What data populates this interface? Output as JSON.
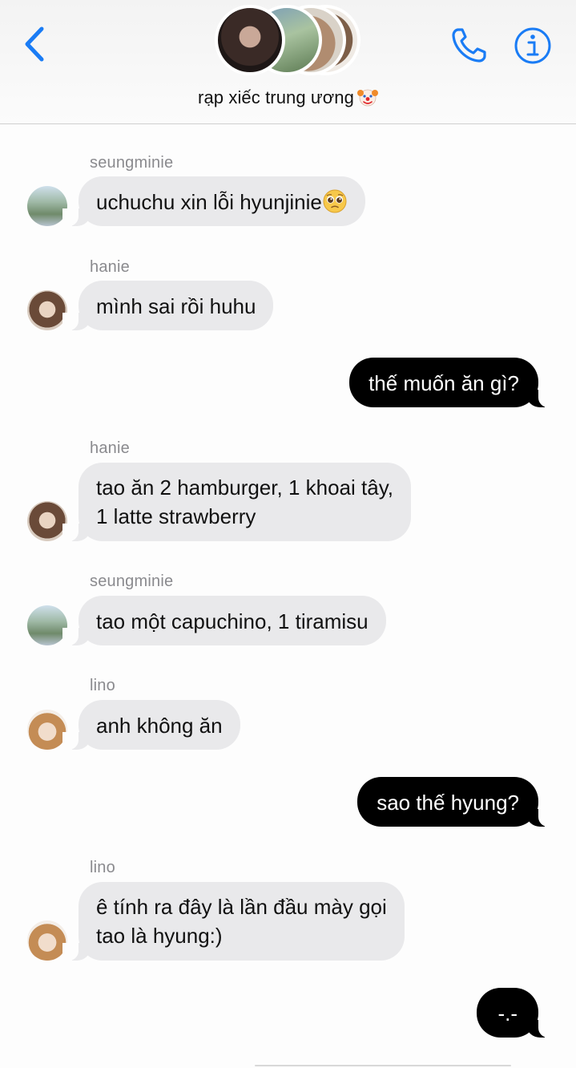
{
  "header": {
    "group_title": "rạp xiếc trung ương",
    "icons": {
      "back": "chevron-left-icon",
      "call": "phone-icon",
      "info": "info-icon",
      "emoji": "clown-face-icon"
    },
    "accent_color": "#1a7cf5"
  },
  "messages": [
    {
      "sender": "seungminie",
      "text": "uchuchu xin lỗi hyunjinie",
      "emoji": "pleading-face-icon",
      "direction": "incoming"
    },
    {
      "sender": "hanie",
      "text": "mình sai rồi huhu",
      "direction": "incoming"
    },
    {
      "text": "thế muốn ăn gì?",
      "direction": "outgoing"
    },
    {
      "sender": "hanie",
      "text_line1": "tao ăn 2 hamburger, 1 khoai tây,",
      "text_line2": "1 latte strawberry",
      "direction": "incoming"
    },
    {
      "sender": "seungminie",
      "text": "tao một capuchino, 1 tiramisu",
      "direction": "incoming"
    },
    {
      "sender": "lino",
      "text": "anh không ăn",
      "direction": "incoming"
    },
    {
      "text": "sao thế hyung?",
      "direction": "outgoing"
    },
    {
      "sender": "lino",
      "text_line1": "ê tính ra đây là lần đầu mày gọi",
      "text_line2": "tao là hyung:)",
      "direction": "incoming"
    },
    {
      "text": "-.-",
      "direction": "outgoing"
    }
  ],
  "colors": {
    "incoming_bubble": "#e9e9eb",
    "outgoing_bubble": "#000000",
    "sender_label": "#8a8a8e"
  }
}
